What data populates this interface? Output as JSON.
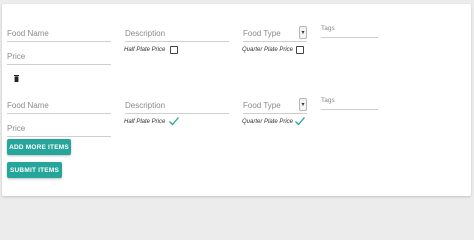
{
  "rows": [
    {
      "food_name": {
        "placeholder": "Food Name"
      },
      "description": {
        "placeholder": "Description"
      },
      "food_type": {
        "placeholder": "Food Type"
      },
      "tags": {
        "placeholder": "Tags"
      },
      "price": {
        "placeholder": "Price"
      },
      "half_plate": {
        "label": "Half Plate Price",
        "checked": false
      },
      "quarter_plate": {
        "label": "Quarter Plate Price",
        "checked": false
      },
      "delete_icon": "trash-icon"
    },
    {
      "food_name": {
        "placeholder": "Food Name"
      },
      "description": {
        "placeholder": "Description"
      },
      "food_type": {
        "placeholder": "Food Type"
      },
      "tags": {
        "placeholder": "Tags"
      },
      "price": {
        "placeholder": "Price"
      },
      "half_plate": {
        "label": "Half Plate Price",
        "checked": true
      },
      "quarter_plate": {
        "label": "Quarter Plate Price",
        "checked": true
      }
    }
  ],
  "buttons": {
    "add_more": "ADD MORE ITEMS",
    "submit": "SUBMIT ITEMS"
  },
  "colors": {
    "accent": "#26a69a",
    "check": "#26a69a"
  }
}
